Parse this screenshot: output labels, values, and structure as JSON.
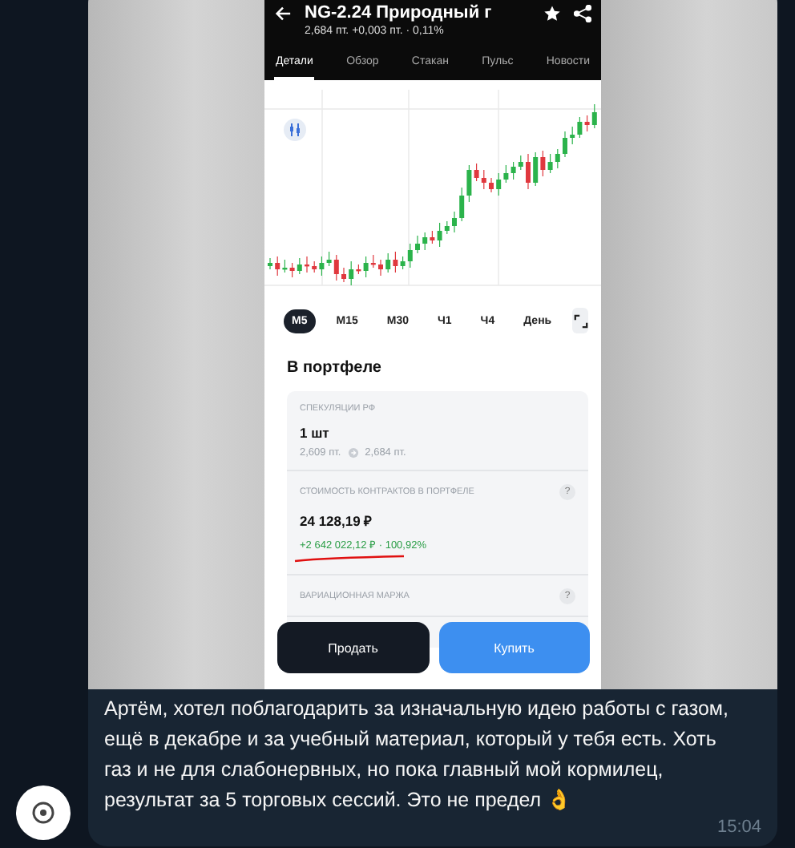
{
  "message": {
    "screenshot": {
      "header": {
        "title": "NG-2.24 Природный г",
        "subtitle": "2,684 пт.  +0,003 пт. · 0,11%"
      },
      "tabs": [
        {
          "label": "Детали",
          "selected": true
        },
        {
          "label": "Обзор",
          "selected": false
        },
        {
          "label": "Стакан",
          "selected": false
        },
        {
          "label": "Пульс",
          "selected": false
        },
        {
          "label": "Новости",
          "selected": false
        }
      ],
      "timeframes": [
        {
          "label": "M5",
          "selected": true
        },
        {
          "label": "M15",
          "selected": false
        },
        {
          "label": "M30",
          "selected": false
        },
        {
          "label": "Ч1",
          "selected": false
        },
        {
          "label": "Ч4",
          "selected": false
        },
        {
          "label": "День",
          "selected": false
        }
      ],
      "portfolio": {
        "heading": "В портфеле",
        "sections": [
          {
            "label": "СПЕКУЛЯЦИИ РФ",
            "value": "1 шт",
            "price_from": "2,609 пт.",
            "price_to": "2,684 пт."
          },
          {
            "label": "СТОИМОСТЬ КОНТРАКТОВ В ПОРТФЕЛЕ",
            "help": "?",
            "value": "24 128,19 ₽",
            "change": "+2 642 022,12 ₽ · 100,92%"
          },
          {
            "label": "ВАРИАЦИОННАЯ МАРЖА",
            "help": "?"
          }
        ]
      },
      "buttons": [
        {
          "label": "Продать",
          "kind": "sell"
        },
        {
          "label": "Купить",
          "kind": "buy"
        }
      ]
    },
    "text": "Артём, хотел поблагодарить за изначальную идею работы с газом, ещё в декабре и за учебный материал, который у тебя есть. Хоть газ и не для слабонервных, но пока главный мой кормилец, результат за 5 торговых сессий. Это не предел 👌",
    "time": "15:04"
  }
}
